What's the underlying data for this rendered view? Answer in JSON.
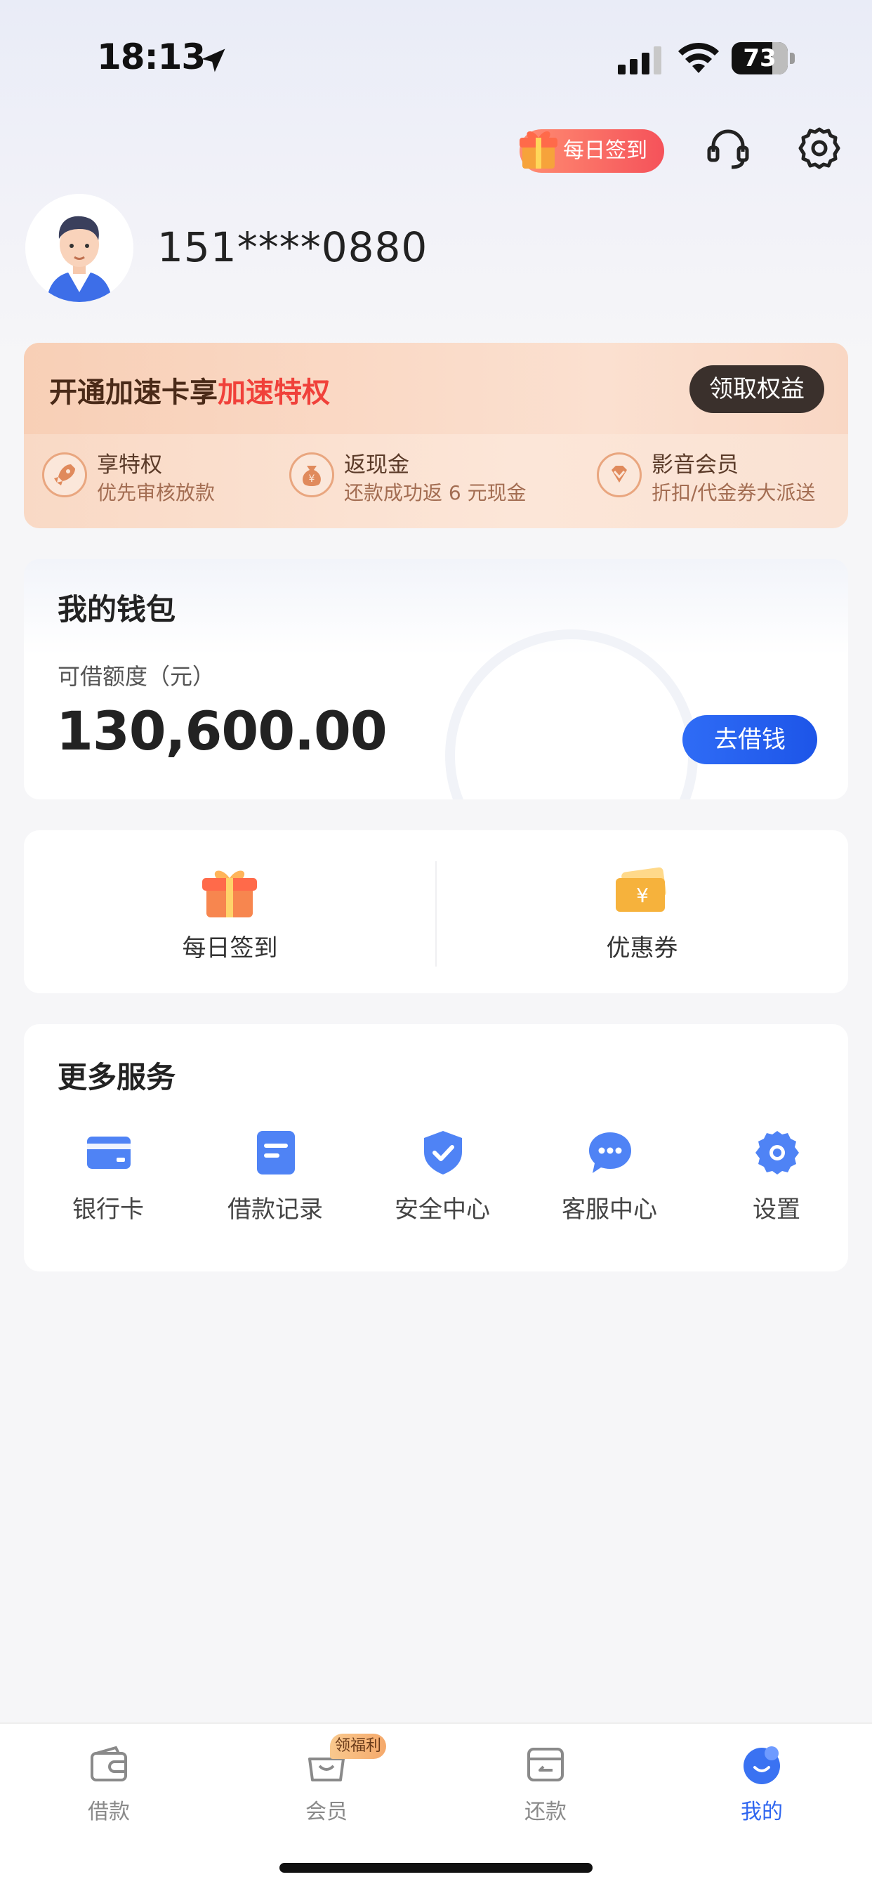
{
  "status_bar": {
    "time": "18:13",
    "battery": "73"
  },
  "header": {
    "checkin_label": "每日签到",
    "icons": [
      "gift-icon",
      "headset-icon",
      "gear-icon"
    ]
  },
  "profile": {
    "phone": "151****0880"
  },
  "vip_card": {
    "title_prefix": "开通加速卡享",
    "title_highlight": "加速特权",
    "button": "领取权益",
    "items": [
      {
        "name": "享特权",
        "sub": "优先审核放款",
        "icon": "rocket-icon"
      },
      {
        "name": "返现金",
        "sub": "还款成功返 6 元现金",
        "icon": "money-bag-icon"
      },
      {
        "name": "影音会员",
        "sub": "折扣/代金券大派送",
        "icon": "diamond-icon"
      }
    ]
  },
  "wallet": {
    "title": "我的钱包",
    "label": "可借额度（元）",
    "amount": "130,600.00",
    "button": "去借钱"
  },
  "quick": [
    {
      "label": "每日签到",
      "icon": "gift-box-icon"
    },
    {
      "label": "优惠券",
      "icon": "coupon-icon"
    }
  ],
  "services": {
    "title": "更多服务",
    "items": [
      {
        "label": "银行卡",
        "icon": "bank-card-icon"
      },
      {
        "label": "借款记录",
        "icon": "record-icon"
      },
      {
        "label": "安全中心",
        "icon": "shield-icon"
      },
      {
        "label": "客服中心",
        "icon": "chat-icon"
      },
      {
        "label": "设置",
        "icon": "settings-icon"
      }
    ]
  },
  "tabbar": {
    "badge": "领福利",
    "tabs": [
      {
        "label": "借款",
        "icon": "wallet-icon",
        "active": false
      },
      {
        "label": "会员",
        "icon": "basket-icon",
        "active": false
      },
      {
        "label": "还款",
        "icon": "repay-icon",
        "active": false
      },
      {
        "label": "我的",
        "icon": "profile-icon",
        "active": true
      }
    ]
  },
  "colors": {
    "accent": "#2f66f0",
    "highlight": "#f0413a",
    "vip_button": "#3a302c"
  }
}
